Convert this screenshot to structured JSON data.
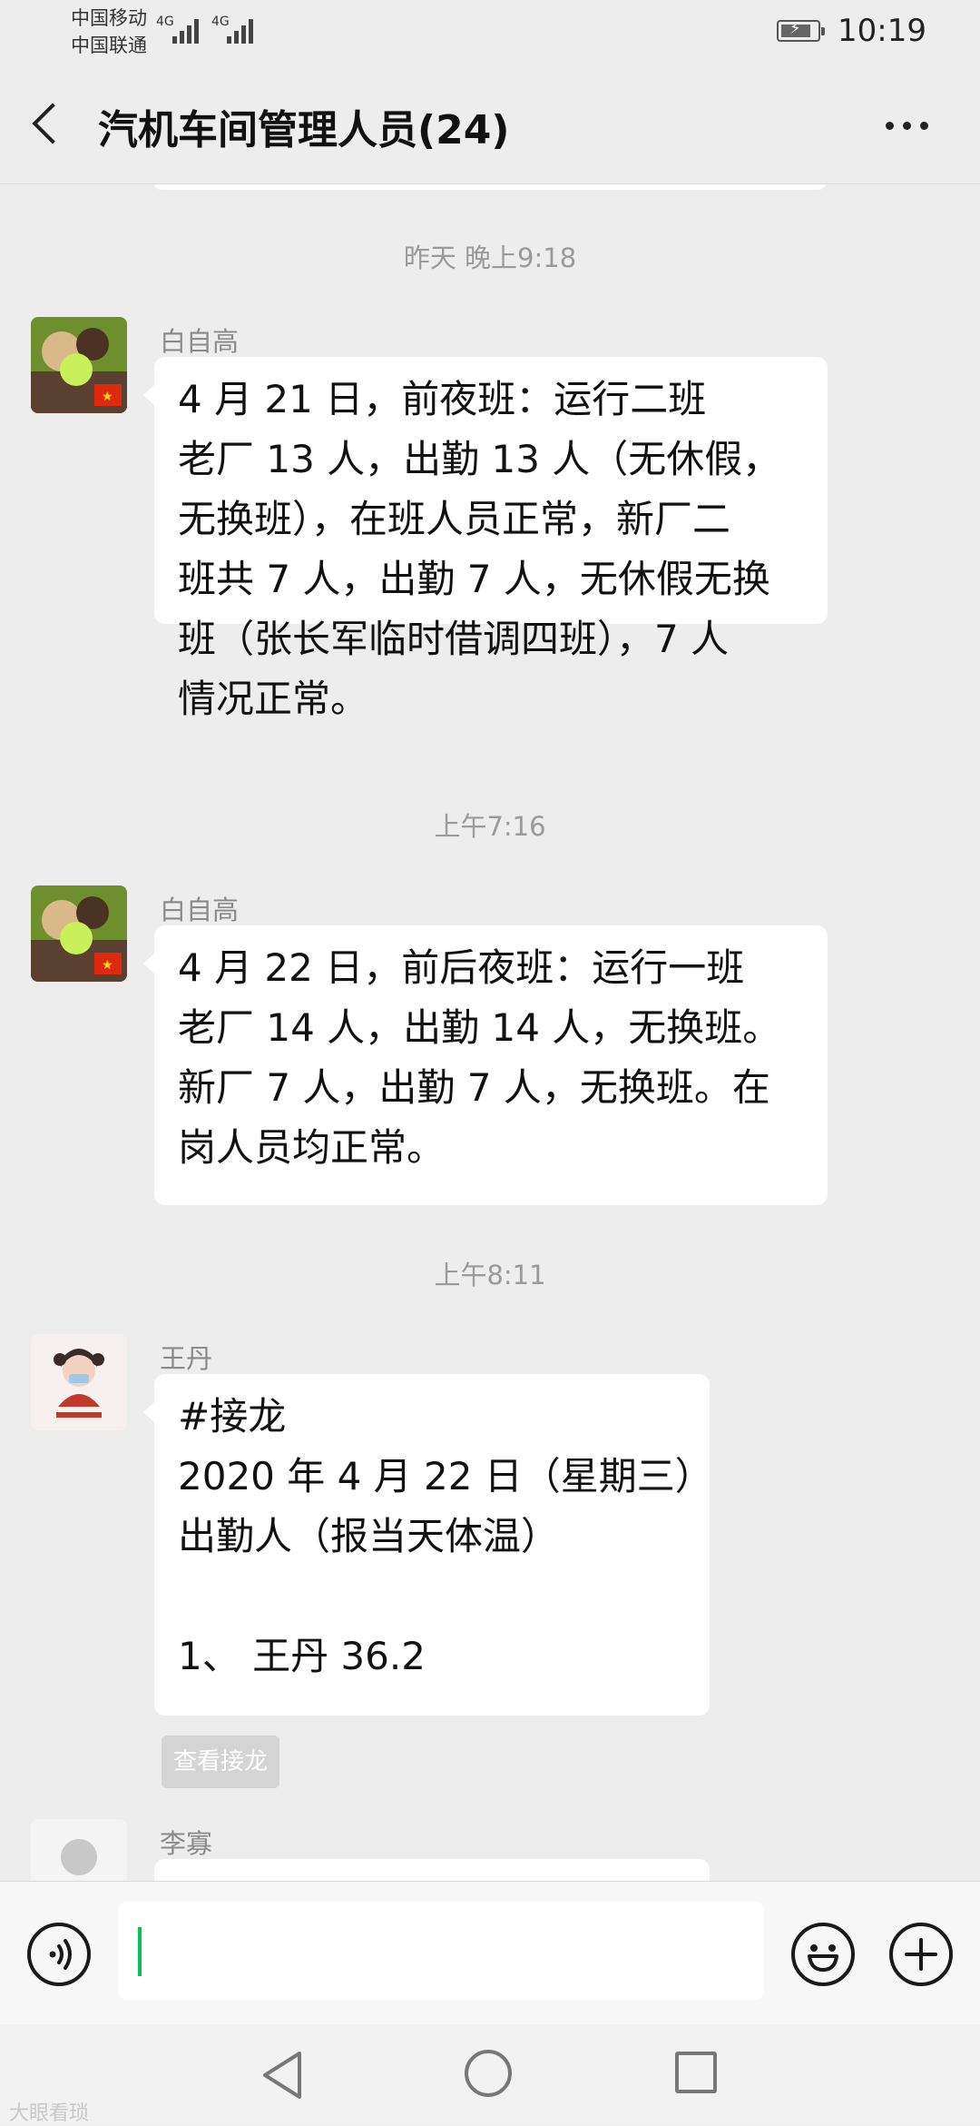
{
  "status_bar": {
    "carrier_1": "中国移动",
    "carrier_2": "中国联通",
    "network_1": "4G",
    "network_2": "4G",
    "time": "10:19"
  },
  "header": {
    "title": "汽机车间管理人员(24)",
    "back_icon": "chevron-left-icon",
    "more_icon": "more-dots-icon"
  },
  "chat": {
    "messages": [
      {
        "timestamp": "昨天 晚上9:18",
        "sender": "白自高",
        "lines": [
          "4 月 21 日，前夜班：运行二班",
          "老厂 13 人，出勤 13 人（无休假，",
          "无换班），在班人员正常，新厂二",
          "班共 7 人，出勤 7 人，无休假无换",
          "班（张长军临时借调四班），7 人",
          "情况正常。"
        ]
      },
      {
        "timestamp": "上午7:16",
        "sender": "白自高",
        "lines": [
          "4 月 22 日，前后夜班：运行一班",
          "老厂 14 人，出勤 14 人，无换班。",
          "新厂 7 人，出勤 7 人，无换班。在",
          "岗人员均正常。"
        ]
      },
      {
        "timestamp": "上午8:11",
        "sender": "王丹",
        "lines": [
          "#接龙",
          "2020 年 4 月 22 日（星期三）",
          "出勤人（报当天体温）",
          "",
          "1、 王丹 36.2"
        ],
        "action_label": "查看接龙"
      },
      {
        "sender": "李寡"
      }
    ]
  },
  "input_bar": {
    "voice_icon": "voice-icon",
    "emoji_icon": "emoji-icon",
    "plus_icon": "plus-icon"
  },
  "nav_bar": {
    "back_icon": "nav-back-icon",
    "home_icon": "nav-home-icon",
    "recents_icon": "nav-recents-icon"
  },
  "watermark": "大眼看琐"
}
